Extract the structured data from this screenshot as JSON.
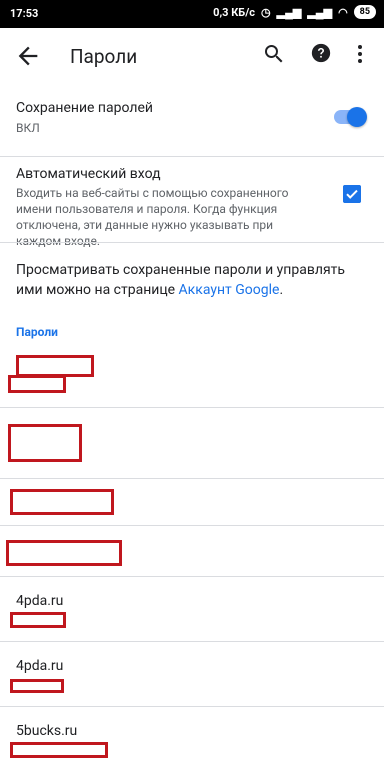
{
  "status_bar": {
    "time": "17:53",
    "network_speed": "0,3 КБ/с",
    "battery": "85"
  },
  "toolbar": {
    "title": "Пароли"
  },
  "save_passwords": {
    "title": "Сохранение паролей",
    "state": "ВКЛ",
    "enabled": true
  },
  "auto_signin": {
    "title": "Автоматический вход",
    "description": "Входить на веб-сайты с помощью сохраненного имени пользователя и пароля. Когда функция отключена, эти данные нужно указывать при каждом входе.",
    "checked": true
  },
  "info": {
    "text_before_link": "Просматривать сохраненные пароли и управлять ими можно на странице ",
    "link_text": "Аккаунт Google",
    "text_after_link": "."
  },
  "passwords_header": "Пароли",
  "password_entries": [
    {
      "site": "",
      "redacted": true
    },
    {
      "site": "",
      "redacted": true
    },
    {
      "site": "",
      "redacted": true
    },
    {
      "site": "",
      "redacted": true
    },
    {
      "site": "4pda.ru",
      "redacted": false
    },
    {
      "site": "4pda.ru",
      "redacted": false
    },
    {
      "site": "5bucks.ru",
      "redacted": false
    }
  ],
  "colors": {
    "accent": "#1a73e8",
    "redaction": "#c0171e"
  }
}
